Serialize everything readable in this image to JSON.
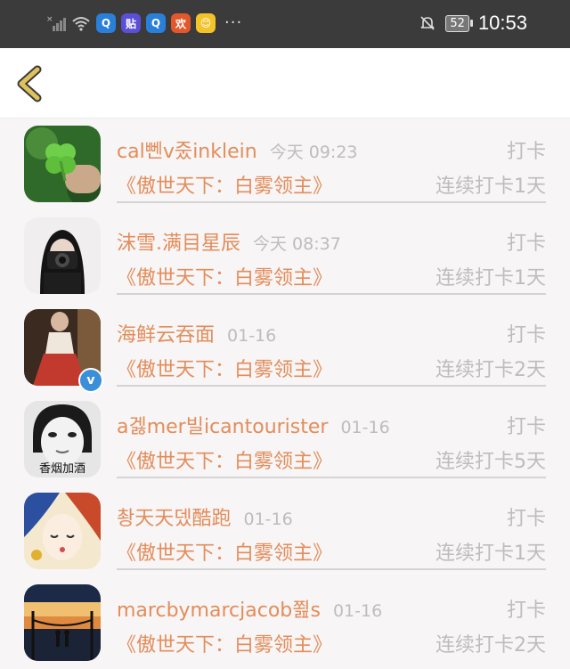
{
  "status_bar": {
    "battery": "52",
    "time": "10:53",
    "app_badges": [
      "Q",
      "贴",
      "Q",
      "欢",
      "😊"
    ],
    "overflow": "···"
  },
  "colors": {
    "accent": "#e38d5a",
    "muted": "#bdbdbd",
    "status_bar_bg": "#3b3b3b",
    "back_arrow": "#d9b84a"
  },
  "header": {
    "back_icon": "chevron-left-icon"
  },
  "entries": [
    {
      "name": "cal뻰v줐inklein",
      "time": "今天 09:23",
      "action": "打卡",
      "book": "《傲世天下：白雾领主》",
      "streak": "连续打卡1天",
      "verified": false
    },
    {
      "name": "沫雪.满目星辰",
      "time": "今天 08:37",
      "action": "打卡",
      "book": "《傲世天下：白雾领主》",
      "streak": "连续打卡1天",
      "verified": false
    },
    {
      "name": "海鲜云吞面",
      "time": "01-16",
      "action": "打卡",
      "book": "《傲世天下：白雾领主》",
      "streak": "连续打卡2天",
      "verified": true
    },
    {
      "name": "a겛mer빌icantourister",
      "time": "01-16",
      "action": "打卡",
      "book": "《傲世天下：白雾领主》",
      "streak": "连续打卡5天",
      "verified": false,
      "avatar_text": "香烟加酒"
    },
    {
      "name": "촹天天뎄酷跑",
      "time": "01-16",
      "action": "打卡",
      "book": "《傲世天下：白雾领主》",
      "streak": "连续打卡1天",
      "verified": false
    },
    {
      "name": "marcbymarcjacob쬞s",
      "time": "01-16",
      "action": "打卡",
      "book": "《傲世天下：白雾领主》",
      "streak": "连续打卡2天",
      "verified": false
    }
  ]
}
